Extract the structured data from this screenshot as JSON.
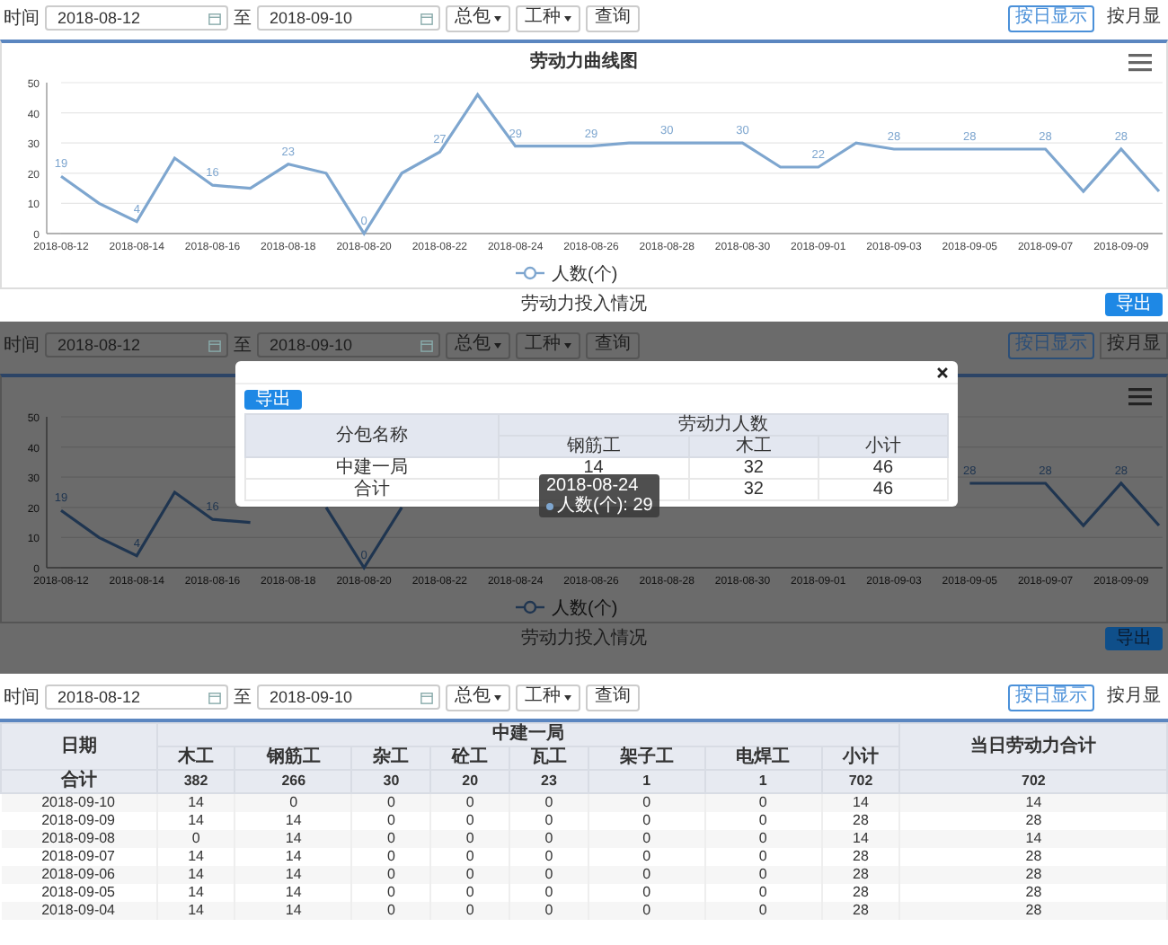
{
  "panels": [
    {
      "kind": "chart",
      "toolbar": {
        "label": "时间",
        "start_date": "2018-08-12",
        "separator": "至",
        "end_date": "2018-09-10",
        "dropdowns": [
          "总包",
          "工种"
        ],
        "query_button": "查询",
        "view_toggle": [
          {
            "label": "按日显示",
            "selected": true
          },
          {
            "label": "按月显",
            "selected": false
          }
        ]
      },
      "chart": {
        "chart_data": {
          "type": "line",
          "title": "劳动力曲线图",
          "categories": [
            "2018-08-12",
            null,
            "2018-08-14",
            null,
            "2018-08-16",
            null,
            "2018-08-18",
            null,
            "2018-08-20",
            null,
            "2018-08-22",
            null,
            "2018-08-24",
            null,
            "2018-08-26",
            null,
            "2018-08-28",
            null,
            "2018-08-30",
            null,
            "2018-09-01",
            null,
            "2018-09-03",
            null,
            "2018-09-05",
            null,
            "2018-09-07",
            null,
            "2018-09-09",
            null
          ],
          "series": [
            {
              "name": "人数(个)",
              "color": "#7ea6cf",
              "values": [
                19,
                10,
                4,
                25,
                16,
                15,
                23,
                20,
                0,
                20,
                27,
                46,
                29,
                29,
                29,
                30,
                30,
                30,
                30,
                22,
                22,
                30,
                28,
                28,
                28,
                28,
                28,
                14,
                28,
                14
              ]
            }
          ],
          "value_labels": [
            "19",
            null,
            "4",
            null,
            "16",
            null,
            "23",
            null,
            "0",
            null,
            "27",
            null,
            "29",
            null,
            "29",
            null,
            "30",
            null,
            "30",
            null,
            "22",
            null,
            "28",
            null,
            "28",
            null,
            "28",
            null,
            "28",
            null
          ],
          "ylim": [
            0,
            50
          ],
          "yticks": [
            0,
            10,
            20,
            30,
            40,
            50
          ],
          "grid": true
        }
      },
      "footer": {
        "title": "劳动力投入情况",
        "export_button": "导出"
      }
    },
    {
      "kind": "chart_modal",
      "toolbar": {
        "label": "时间",
        "start_date": "2018-08-12",
        "separator": "至",
        "end_date": "2018-09-10",
        "dropdowns": [
          "总包",
          "工种"
        ],
        "query_button": "查询",
        "view_toggle": [
          {
            "label": "按日显示",
            "selected": true
          },
          {
            "label": "按月显",
            "selected": false
          }
        ]
      },
      "chart": {
        "chart_data": {
          "type": "line",
          "categories": [
            "2018-08-12",
            null,
            "2018-08-14",
            null,
            "2018-08-16",
            null,
            "2018-08-18",
            null,
            "2018-08-20",
            null,
            "2018-08-22",
            null,
            "2018-08-24",
            null,
            "2018-08-26",
            null,
            "2018-08-28",
            null,
            "2018-08-30",
            null,
            "2018-09-01",
            null,
            "2018-09-03",
            null,
            "2018-09-05",
            null,
            "2018-09-07",
            null,
            "2018-09-09",
            null
          ],
          "series": [
            {
              "name": "人数(个)",
              "color": "#1f3550",
              "values": [
                19,
                10,
                4,
                25,
                16,
                15,
                null,
                20,
                0,
                20,
                null,
                null,
                null,
                null,
                null,
                null,
                null,
                null,
                null,
                null,
                null,
                null,
                null,
                null,
                28,
                28,
                28,
                14,
                28,
                14
              ]
            }
          ],
          "value_labels": [
            "19",
            null,
            "4",
            null,
            "16",
            null,
            null,
            null,
            "0",
            null,
            null,
            null,
            null,
            null,
            null,
            null,
            null,
            null,
            null,
            null,
            null,
            null,
            null,
            null,
            "28",
            null,
            "28",
            null,
            "28",
            null
          ],
          "ylim": [
            0,
            50
          ],
          "yticks": [
            0,
            10,
            20,
            30,
            40,
            50
          ],
          "grid": true
        }
      },
      "footer": {
        "title": "劳动力投入情况",
        "export_button": "导出"
      },
      "modal": {
        "export_button": "导出",
        "table": {
          "name_header": "分包名称",
          "group_header": "劳动力人数",
          "columns": [
            "钢筋工",
            "木工",
            "小计"
          ],
          "rows": [
            {
              "name": "中建一局",
              "values": [
                "14",
                "32",
                "46"
              ]
            },
            {
              "name": "合计",
              "values": [
                "32",
                "46"
              ]
            }
          ]
        }
      },
      "tooltip": {
        "date": "2018-08-24",
        "label": "人数(个): 29"
      }
    },
    {
      "kind": "table",
      "toolbar": {
        "label": "时间",
        "start_date": "2018-08-12",
        "separator": "至",
        "end_date": "2018-09-10",
        "dropdowns": [
          "总包",
          "工种"
        ],
        "query_button": "查询",
        "view_toggle": [
          {
            "label": "按日显示",
            "selected": true
          },
          {
            "label": "按月显",
            "selected": false
          }
        ]
      },
      "table": {
        "date_header": "日期",
        "group_header": "中建一局",
        "total_header": "当日劳动力合计",
        "trade_columns": [
          "木工",
          "钢筋工",
          "杂工",
          "砼工",
          "瓦工",
          "架子工",
          "电焊工",
          "小计"
        ],
        "totals_row": {
          "label": "合计",
          "values": [
            "382",
            "266",
            "30",
            "20",
            "23",
            "1",
            "1",
            "702",
            "702"
          ]
        },
        "rows": [
          {
            "date": "2018-09-10",
            "values": [
              "14",
              "0",
              "0",
              "0",
              "0",
              "0",
              "0",
              "14",
              "14"
            ]
          },
          {
            "date": "2018-09-09",
            "values": [
              "14",
              "14",
              "0",
              "0",
              "0",
              "0",
              "0",
              "28",
              "28"
            ]
          },
          {
            "date": "2018-09-08",
            "values": [
              "0",
              "14",
              "0",
              "0",
              "0",
              "0",
              "0",
              "14",
              "14"
            ]
          },
          {
            "date": "2018-09-07",
            "values": [
              "14",
              "14",
              "0",
              "0",
              "0",
              "0",
              "0",
              "28",
              "28"
            ]
          },
          {
            "date": "2018-09-06",
            "values": [
              "14",
              "14",
              "0",
              "0",
              "0",
              "0",
              "0",
              "28",
              "28"
            ]
          },
          {
            "date": "2018-09-05",
            "values": [
              "14",
              "14",
              "0",
              "0",
              "0",
              "0",
              "0",
              "28",
              "28"
            ]
          },
          {
            "date": "2018-09-04",
            "values": [
              "14",
              "14",
              "0",
              "0",
              "0",
              "0",
              "0",
              "28",
              "28"
            ]
          }
        ]
      }
    }
  ]
}
